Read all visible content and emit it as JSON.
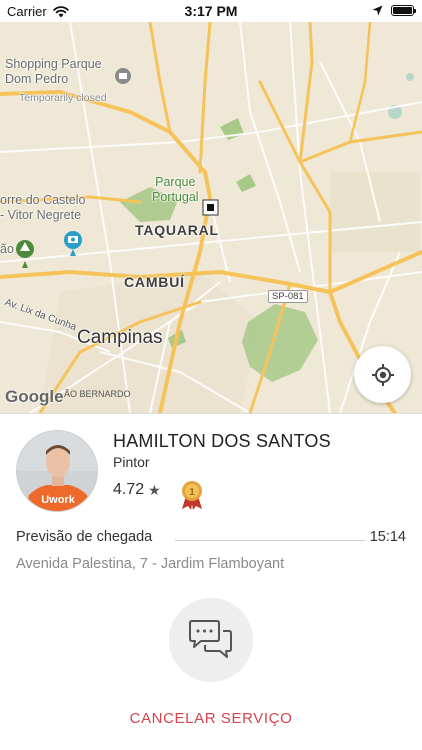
{
  "status_bar": {
    "carrier": "Carrier",
    "time": "3:17 PM"
  },
  "map": {
    "labels": {
      "shopping": "Shopping Parque\nDom Pedro",
      "temporarily_closed": "Temporarily closed",
      "castelo": "orre do Castelo\n- Vitor Negrete",
      "park_portugal": "Parque\nPortugal",
      "taquaral": "TAQUARAL",
      "cambui": "CAMBUÍ",
      "campinas": "Campinas",
      "av_lix": "Av. Lix da Cunha",
      "route": "SP-081",
      "sao_bernardo": "ÃO BERNARDO",
      "left_edge": "ão"
    },
    "attribution": "Google"
  },
  "professional": {
    "name": "HAMILTON DOS SANTOS",
    "profession": "Pintor",
    "rating": "4.72",
    "shirt_text": "Uwork"
  },
  "eta": {
    "label": "Previsão de chegada",
    "time": "15:14"
  },
  "address": "Avenida Palestina, 7 - Jardim Flamboyant",
  "actions": {
    "cancel_label": "CANCELAR SERVIÇO"
  },
  "colors": {
    "accent": "#d4434e",
    "badge_gold": "#e6a23c",
    "badge_ribbon": "#c0392b",
    "map_base": "#efe8d6",
    "map_road": "#f5c35a",
    "map_park": "#a8c98a"
  },
  "icons": {
    "wifi": "wifi-icon",
    "location_arrow": "location-arrow-icon",
    "battery": "battery-icon",
    "locate": "crosshair-icon",
    "chat": "chat-bubbles-icon",
    "badge": "award-medal-icon",
    "star": "star-icon"
  }
}
